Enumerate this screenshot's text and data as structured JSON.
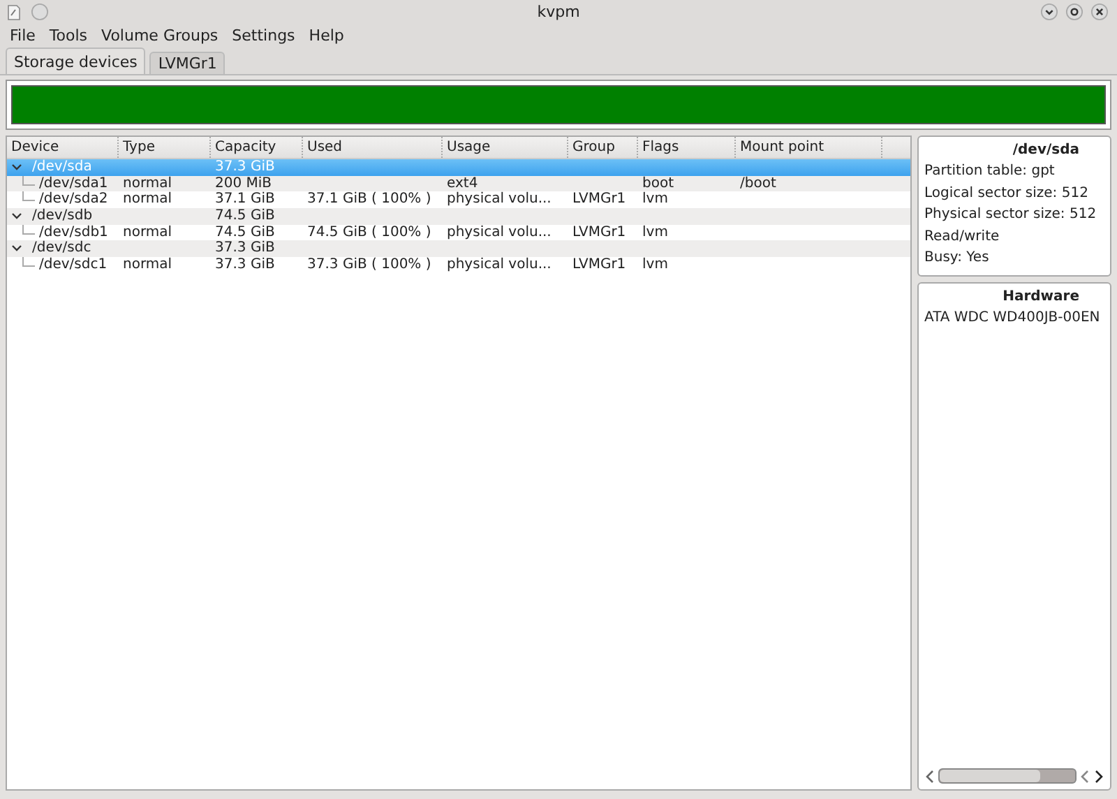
{
  "window": {
    "title": "kvpm"
  },
  "menu": [
    "File",
    "Tools",
    "Volume Groups",
    "Settings",
    "Help"
  ],
  "tabs": [
    {
      "label": "Storage devices",
      "selected": true
    },
    {
      "label": "LVMGr1",
      "selected": false
    }
  ],
  "table": {
    "columns": [
      "Device",
      "Type",
      "Capacity",
      "Used",
      "Usage",
      "Group",
      "Flags",
      "Mount point"
    ],
    "rows": [
      {
        "cells": [
          "/dev/sda",
          "",
          "37.3 GiB",
          "",
          "",
          "",
          "",
          ""
        ],
        "selected": true,
        "expanded": true,
        "children": [
          {
            "cells": [
              "/dev/sda1",
              "normal",
              "200 MiB",
              "",
              "ext4",
              "",
              "boot",
              "/boot"
            ],
            "selected": false
          },
          {
            "cells": [
              "/dev/sda2",
              "normal",
              "37.1 GiB",
              "37.1 GiB ( 100% )",
              "physical volu...",
              "LVMGr1",
              "lvm",
              ""
            ],
            "selected": false
          }
        ]
      },
      {
        "cells": [
          "/dev/sdb",
          "",
          "74.5 GiB",
          "",
          "",
          "",
          "",
          ""
        ],
        "selected": false,
        "expanded": true,
        "children": [
          {
            "cells": [
              "/dev/sdb1",
              "normal",
              "74.5 GiB",
              "74.5 GiB ( 100% )",
              "physical volu...",
              "LVMGr1",
              "lvm",
              ""
            ],
            "selected": false
          }
        ]
      },
      {
        "cells": [
          "/dev/sdc",
          "",
          "37.3 GiB",
          "",
          "",
          "",
          "",
          ""
        ],
        "selected": false,
        "expanded": true,
        "children": [
          {
            "cells": [
              "/dev/sdc1",
              "normal",
              "37.3 GiB",
              "37.3 GiB ( 100% )",
              "physical volu...",
              "LVMGr1",
              "lvm",
              ""
            ],
            "selected": false
          }
        ]
      }
    ]
  },
  "details": {
    "title": "/dev/sda",
    "lines": [
      "Partition table: gpt",
      "Logical sector size: 512",
      "Physical sector size: 512",
      "Read/write",
      "Busy: Yes"
    ]
  },
  "hardware": {
    "title": "Hardware",
    "lines": [
      "ATA WDC WD400JB-00EN"
    ]
  }
}
